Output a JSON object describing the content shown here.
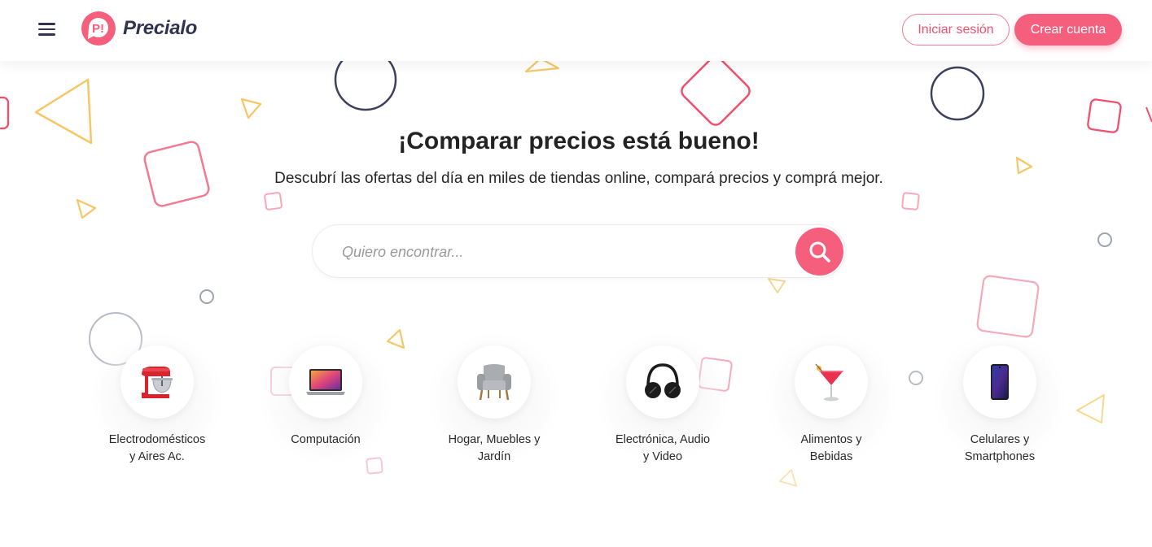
{
  "header": {
    "brand": "Precialo",
    "login_label": "Iniciar sesión",
    "signup_label": "Crear cuenta"
  },
  "hero": {
    "title": "¡Comparar precios está bueno!",
    "subtitle": "Descubrí las ofertas del día en miles de tiendas online, compará precios y comprá mejor."
  },
  "search": {
    "placeholder": "Quiero encontrar...",
    "value": ""
  },
  "categories": [
    {
      "label": "Electrodomésticos\ny Aires Ac.",
      "icon": "stand-mixer-icon"
    },
    {
      "label": "Computación",
      "icon": "laptop-icon"
    },
    {
      "label": "Hogar, Muebles y\nJardín",
      "icon": "armchair-icon"
    },
    {
      "label": "Electrónica, Audio\ny Video",
      "icon": "headphones-icon"
    },
    {
      "label": "Alimentos y\nBebidas",
      "icon": "cocktail-icon"
    },
    {
      "label": "Celulares y\nSmartphones",
      "icon": "smartphone-icon"
    }
  ],
  "colors": {
    "brand_pink": "#f55f7d",
    "brand_navy": "#2f3550",
    "deco_yellow": "#f5c767",
    "deco_pink": "#f5a3b5",
    "deco_gray": "#9ea3b0"
  }
}
